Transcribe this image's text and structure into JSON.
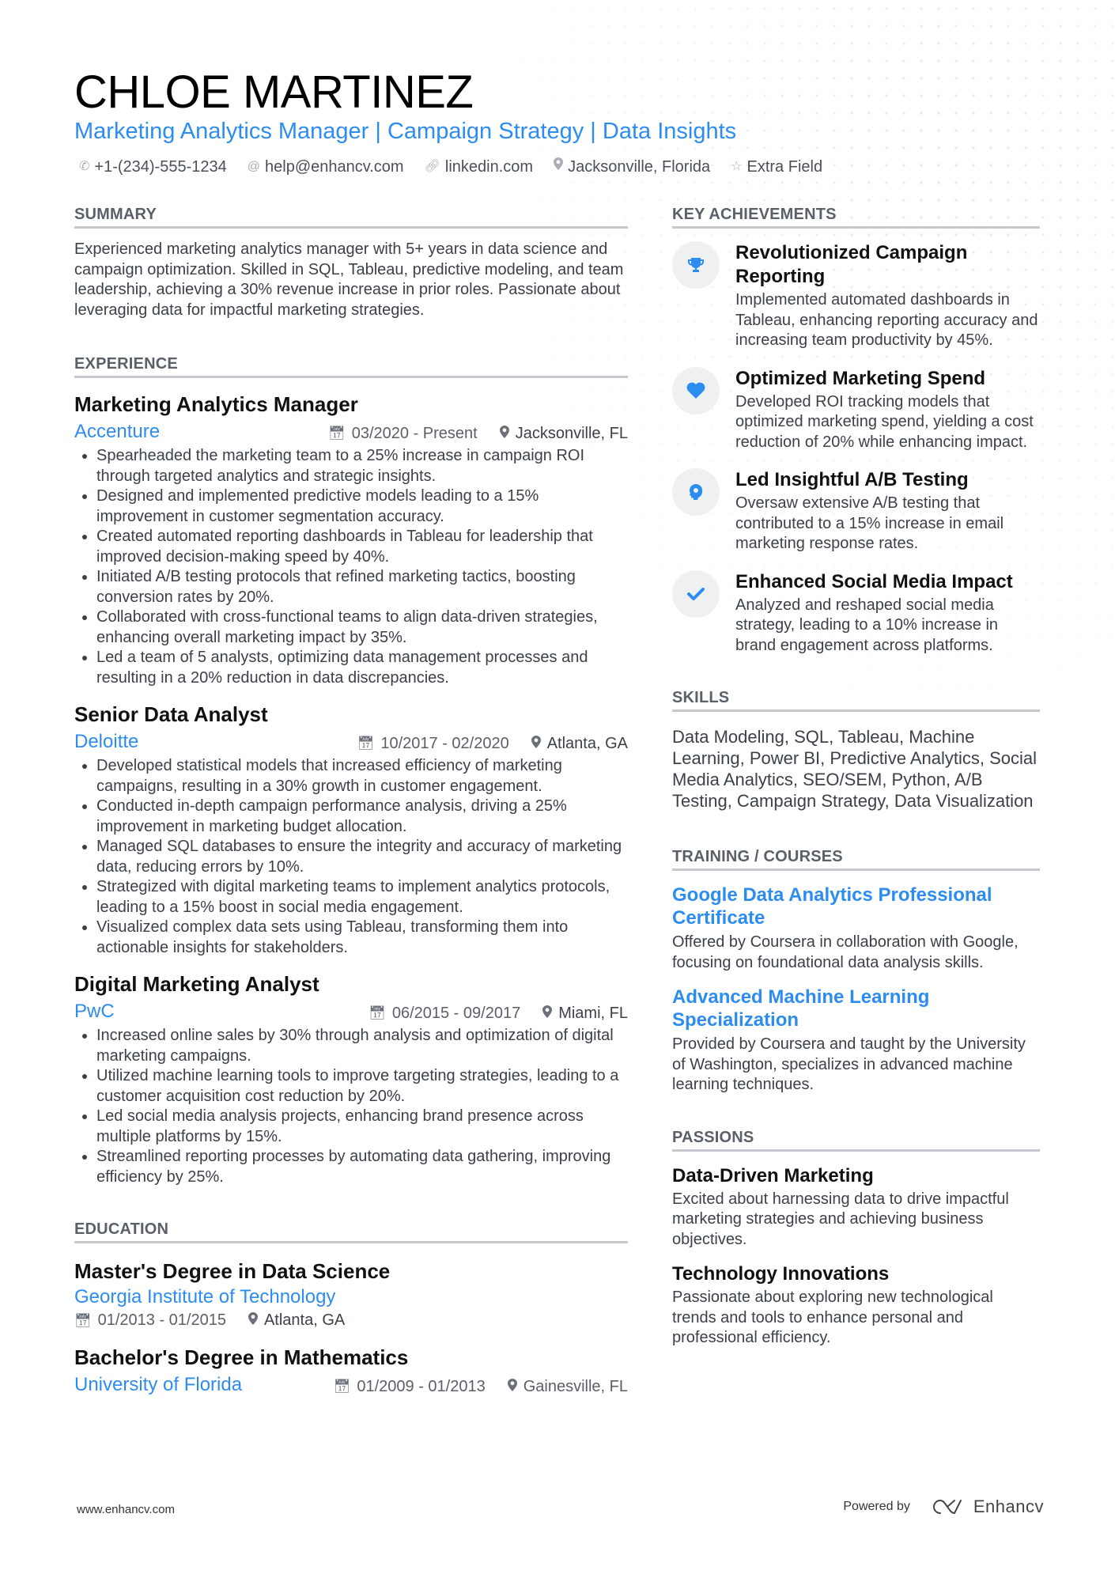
{
  "header": {
    "name": "CHLOE MARTINEZ",
    "tagline": "Marketing Analytics Manager | Campaign Strategy | Data Insights",
    "contacts": [
      {
        "icon": "phone-icon",
        "text": "+1-(234)-555-1234"
      },
      {
        "icon": "at-icon",
        "text": "help@enhancv.com"
      },
      {
        "icon": "link-icon",
        "text": "linkedin.com"
      },
      {
        "icon": "location-icon",
        "text": "Jacksonville, Florida"
      },
      {
        "icon": "star-icon",
        "text": "Extra Field"
      }
    ]
  },
  "summary": {
    "title": "SUMMARY",
    "text": "Experienced marketing analytics manager with 5+ years in data science and campaign optimization. Skilled in SQL, Tableau, predictive modeling, and team leadership, achieving a 30% revenue increase in prior roles. Passionate about leveraging data for impactful marketing strategies."
  },
  "experience": {
    "title": "EXPERIENCE",
    "jobs": [
      {
        "title": "Marketing Analytics Manager",
        "company": "Accenture",
        "dates": "03/2020 - Present",
        "location": "Jacksonville, FL",
        "bullets": [
          "Spearheaded the marketing team to a 25% increase in campaign ROI through targeted analytics and strategic insights.",
          "Designed and implemented predictive models leading to a 15% improvement in customer segmentation accuracy.",
          "Created automated reporting dashboards in Tableau for leadership that improved decision-making speed by 40%.",
          "Initiated A/B testing protocols that refined marketing tactics, boosting conversion rates by 20%.",
          "Collaborated with cross-functional teams to align data-driven strategies, enhancing overall marketing impact by 35%.",
          "Led a team of 5 analysts, optimizing data management processes and resulting in a 20% reduction in data discrepancies."
        ]
      },
      {
        "title": "Senior Data Analyst",
        "company": "Deloitte",
        "dates": "10/2017 - 02/2020",
        "location": "Atlanta, GA",
        "bullets": [
          "Developed statistical models that increased efficiency of marketing campaigns, resulting in a 30% growth in customer engagement.",
          "Conducted in-depth campaign performance analysis, driving a 25% improvement in marketing budget allocation.",
          "Managed SQL databases to ensure the integrity and accuracy of marketing data, reducing errors by 10%.",
          "Strategized with digital marketing teams to implement analytics protocols, leading to a 15% boost in social media engagement.",
          "Visualized complex data sets using Tableau, transforming them into actionable insights for stakeholders."
        ]
      },
      {
        "title": "Digital Marketing Analyst",
        "company": "PwC",
        "dates": "06/2015 - 09/2017",
        "location": "Miami, FL",
        "bullets": [
          "Increased online sales by 30% through analysis and optimization of digital marketing campaigns.",
          "Utilized machine learning tools to improve targeting strategies, leading to a customer acquisition cost reduction by 20%.",
          "Led social media analysis projects, enhancing brand presence across multiple platforms by 15%.",
          "Streamlined reporting processes by automating data gathering, improving efficiency by 25%."
        ]
      }
    ]
  },
  "education": {
    "title": "EDUCATION",
    "items": [
      {
        "degree": "Master's Degree in Data Science",
        "school": "Georgia Institute of Technology",
        "dates": "01/2013 - 01/2015",
        "location": "Atlanta, GA"
      },
      {
        "degree": "Bachelor's Degree in Mathematics",
        "school": "University of Florida",
        "dates": "01/2009 - 01/2013",
        "location": "Gainesville, FL"
      }
    ]
  },
  "achievements": {
    "title": "KEY ACHIEVEMENTS",
    "items": [
      {
        "icon": "trophy-icon",
        "title": "Revolutionized Campaign Reporting",
        "desc": "Implemented automated dashboards in Tableau, enhancing reporting accuracy and increasing team productivity by 45%."
      },
      {
        "icon": "heart-icon",
        "title": "Optimized Marketing Spend",
        "desc": "Developed ROI tracking models that optimized marketing spend, yielding a cost reduction of 20% while enhancing impact."
      },
      {
        "icon": "head-bulb-icon",
        "title": "Led Insightful A/B Testing",
        "desc": "Oversaw extensive A/B testing that contributed to a 15% increase in email marketing response rates."
      },
      {
        "icon": "checkmark-icon",
        "title": "Enhanced Social Media Impact",
        "desc": "Analyzed and reshaped social media strategy, leading to a 10% increase in brand engagement across platforms."
      }
    ]
  },
  "skills": {
    "title": "SKILLS",
    "text": "Data Modeling, SQL, Tableau, Machine Learning, Power BI, Predictive Analytics, Social Media Analytics, SEO/SEM, Python, A/B Testing, Campaign Strategy, Data Visualization"
  },
  "training": {
    "title": "TRAINING / COURSES",
    "items": [
      {
        "title": "Google Data Analytics Professional Certificate",
        "desc": "Offered by Coursera in collaboration with Google, focusing on foundational data analysis skills."
      },
      {
        "title": "Advanced Machine Learning Specialization",
        "desc": "Provided by Coursera and taught by the University of Washington, specializes in advanced machine learning techniques."
      }
    ]
  },
  "passions": {
    "title": "PASSIONS",
    "items": [
      {
        "title": "Data-Driven Marketing",
        "desc": "Excited about harnessing data to drive impactful marketing strategies and achieving business objectives."
      },
      {
        "title": "Technology Innovations",
        "desc": "Passionate about exploring new technological trends and tools to enhance personal and professional efficiency."
      }
    ]
  },
  "footer": {
    "website": "www.enhancv.com",
    "powered_by": "Powered by",
    "brand": "Enhancv"
  },
  "colors": {
    "accent": "#2d8cf0",
    "text": "#3b4148",
    "heading": "#111111",
    "rule": "#c6c9cd"
  }
}
